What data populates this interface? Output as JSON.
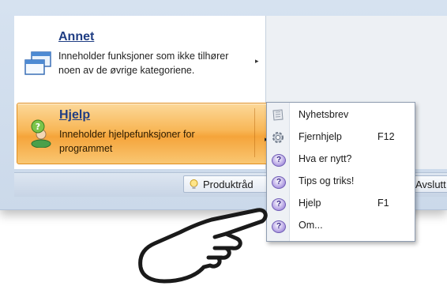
{
  "menu": {
    "annet": {
      "title": "Annet",
      "description": "Inneholder funksjoner som ikke tilhører noen av de øvrige kategoriene.",
      "icon": "windows-icon"
    },
    "hjelp": {
      "title": "Hjelp",
      "description": "Inneholder hjelpefunksjoner for programmet",
      "icon": "help-person-icon"
    }
  },
  "bottom_bar": {
    "produkt_label": "Produktråd",
    "avslutt_label": "Avslutt"
  },
  "submenu": {
    "items": [
      {
        "label": "Nyhetsbrev",
        "shortcut": "",
        "icon": "newsletter-icon"
      },
      {
        "label": "Fjernhjelp",
        "shortcut": "F12",
        "icon": "gear-icon"
      },
      {
        "label": "Hva er nytt?",
        "shortcut": "",
        "icon": "question-icon"
      },
      {
        "label": "Tips og triks!",
        "shortcut": "",
        "icon": "question-icon"
      },
      {
        "label": "Hjelp",
        "shortcut": "F1",
        "icon": "question-icon"
      },
      {
        "label": "Om...",
        "shortcut": "",
        "icon": "question-icon"
      }
    ]
  },
  "colors": {
    "highlight": "#f8b656",
    "title_blue": "#1f3d83",
    "window_bg": "#d6e2f0"
  }
}
